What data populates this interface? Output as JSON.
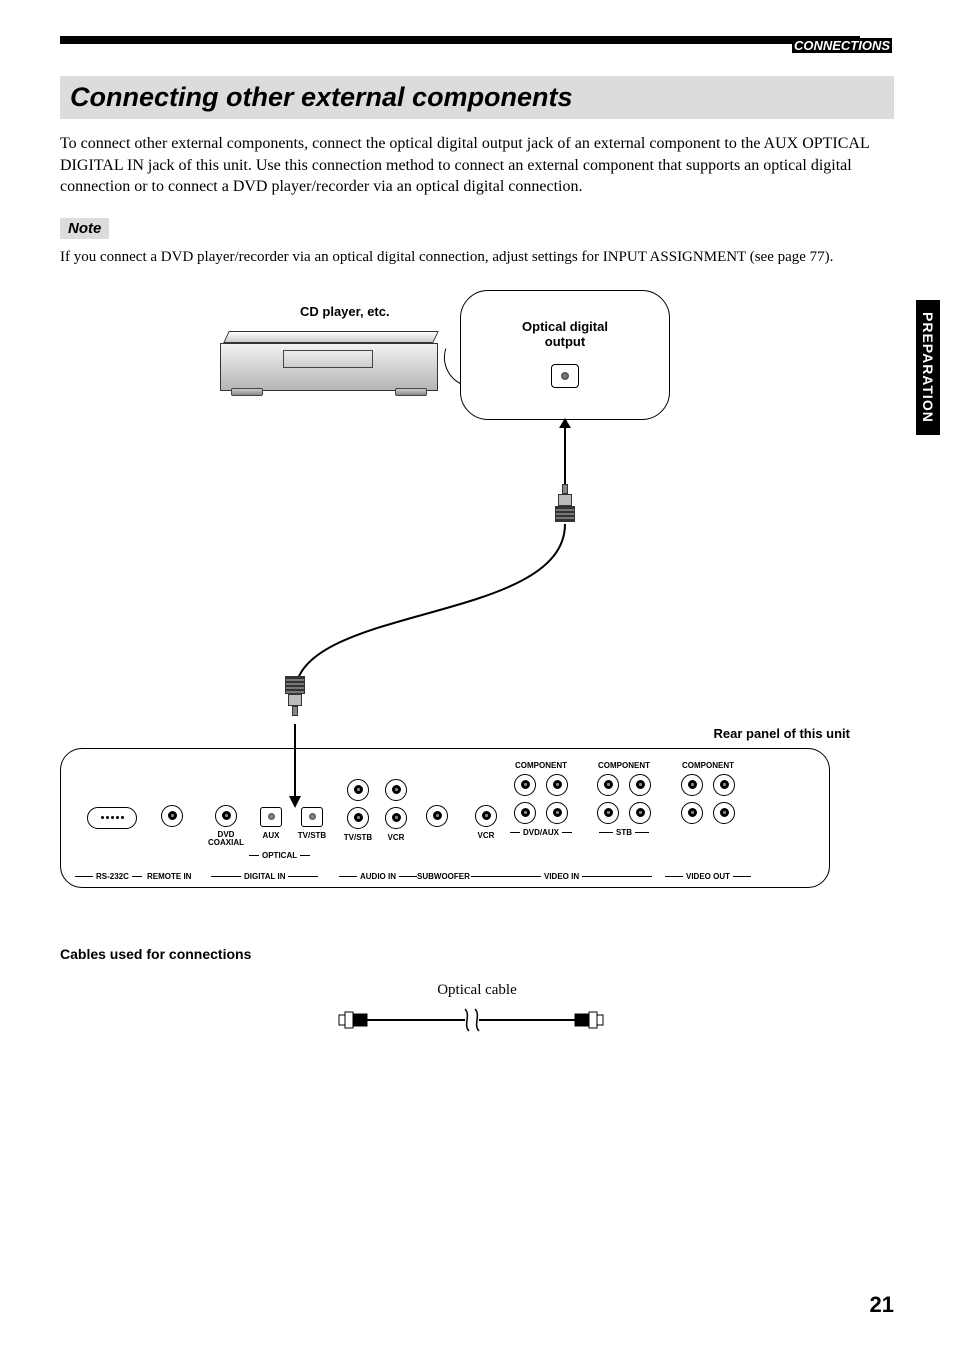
{
  "header": {
    "breadcrumb": "CONNECTIONS"
  },
  "side_tab": "PREPARATION",
  "page_number": "21",
  "section": {
    "title": "Connecting other external components",
    "body": "To connect other external components, connect the optical digital output jack of an external component to the AUX OPTICAL DIGITAL IN jack of this unit. Use this connection method to connect an external component that supports an optical digital connection or to connect a DVD player/recorder via an optical digital connection."
  },
  "note": {
    "label": "Note",
    "text": "If you connect a DVD player/recorder via an optical digital connection, adjust settings for INPUT ASSIGNMENT (see page 77)."
  },
  "diagram": {
    "cd_label": "CD player, etc.",
    "callout_line1": "Optical digital",
    "callout_line2": "output",
    "rear_label": "Rear panel of this unit",
    "component_group_label": "COMPONENT",
    "digital": {
      "dvd_coax": "DVD\nCOAXIAL",
      "aux": "AUX",
      "tvstb": "TV/STB",
      "optical": "OPTICAL"
    },
    "audio_in": {
      "tvstb": "TV/STB",
      "vcr": "VCR"
    },
    "video_in": {
      "vcr": "VCR",
      "dvd_aux": "DVD/AUX",
      "stb": "STB"
    },
    "bottom_labels": {
      "rs232c": "RS-232C",
      "remote_in": "REMOTE IN",
      "digital_in": "DIGITAL IN",
      "audio_in": "AUDIO IN",
      "subwoofer": "SUBWOOFER",
      "video_in": "VIDEO IN",
      "video_out": "VIDEO OUT"
    }
  },
  "cables": {
    "heading": "Cables used for connections",
    "optical_cable": "Optical cable"
  }
}
